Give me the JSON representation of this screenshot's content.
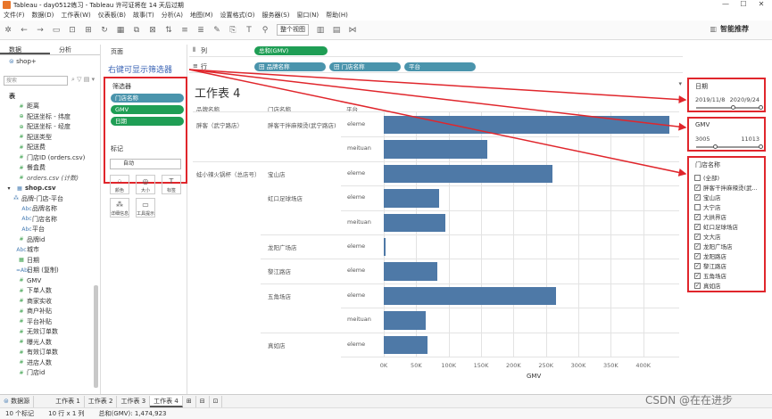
{
  "window": {
    "title": "Tableau - day0512练习 - Tableau 许可证将在 14 天后过期"
  },
  "menu": [
    "文件(F)",
    "数据(D)",
    "工作表(W)",
    "仪表板(B)",
    "故事(T)",
    "分析(A)",
    "地图(M)",
    "设置格式(O)",
    "服务器(S)",
    "窗口(N)",
    "帮助(H)"
  ],
  "toolbar": {
    "view_select": "整个视图",
    "smart_recommend": "智能推荐"
  },
  "data_panel": {
    "tabs": [
      "数据",
      "分析"
    ],
    "source": "shop+",
    "search_placeholder": "搜索",
    "section_table": "表",
    "fields_top": [
      {
        "kind": "msr",
        "label": "距离",
        "icon": "#"
      },
      {
        "kind": "msr",
        "label": "配送坐标 - 纬度",
        "icon": "⊕"
      },
      {
        "kind": "msr",
        "label": "配送坐标 - 经度",
        "icon": "⊕"
      },
      {
        "kind": "msr",
        "label": "配送类型",
        "icon": "#"
      },
      {
        "kind": "msr",
        "label": "配送费",
        "icon": "#"
      },
      {
        "kind": "msr",
        "label": "门店ID (orders.csv)",
        "icon": "#"
      },
      {
        "kind": "msr",
        "label": "餐盒费",
        "icon": "#"
      },
      {
        "kind": "italic",
        "label": "orders.csv (计数)",
        "icon": "#"
      }
    ],
    "shop_table": "shop.csv",
    "hierarchy": "品牌-门店-平台",
    "hierarchy_items": [
      "品牌名称",
      "门店名称",
      "平台"
    ],
    "fields_bottom": [
      {
        "kind": "msr",
        "label": "品牌id",
        "icon": "#"
      },
      {
        "kind": "dim",
        "label": "城市",
        "icon": "Abc"
      },
      {
        "kind": "msr",
        "label": "日期",
        "icon": "▦"
      },
      {
        "kind": "dim",
        "label": "日期 (复制)",
        "icon": "=Abc"
      },
      {
        "kind": "msr",
        "label": "GMV",
        "icon": "#"
      },
      {
        "kind": "msr",
        "label": "下单人数",
        "icon": "#"
      },
      {
        "kind": "msr",
        "label": "商家实收",
        "icon": "#"
      },
      {
        "kind": "msr",
        "label": "商户补贴",
        "icon": "#"
      },
      {
        "kind": "msr",
        "label": "平台补贴",
        "icon": "#"
      },
      {
        "kind": "msr",
        "label": "无效订单数",
        "icon": "#"
      },
      {
        "kind": "msr",
        "label": "曝光人数",
        "icon": "#"
      },
      {
        "kind": "msr",
        "label": "有效订单数",
        "icon": "#"
      },
      {
        "kind": "msr",
        "label": "进店人数",
        "icon": "#"
      },
      {
        "kind": "msr",
        "label": "门店id",
        "icon": "#"
      }
    ]
  },
  "cards": {
    "pages": "页面",
    "filters": "筛选器",
    "annotation": "右键可显示筛选器",
    "filter_pills": [
      "门店名称",
      "GMV",
      "日期"
    ],
    "marks": "标记",
    "marks_type": "自动",
    "mark_buttons": [
      "颜色",
      "大小",
      "标签",
      "详细信息",
      "工具提示"
    ]
  },
  "shelves": {
    "columns_label": "列",
    "columns_pill": "总和(GMV)",
    "rows_label": "行",
    "rows_pills": [
      "田 品牌名称",
      "田 门店名称",
      "平台"
    ]
  },
  "view": {
    "title": "工作表 4",
    "col_headers": [
      "品牌名称",
      "门店名称",
      "平台"
    ],
    "brands": [
      {
        "name": "胖客（武宁路店）",
        "row": 0
      },
      {
        "name": "蛙小辣火锅杯（总店号）",
        "row": 2
      }
    ],
    "stores": [
      {
        "name": "胖客干拌麻辣烫(武宁路店)",
        "row": 0
      },
      {
        "name": "宝山店",
        "row": 2
      },
      {
        "name": "虹口足球场店",
        "row": 3
      },
      {
        "name": "龙阳广场店",
        "row": 5
      },
      {
        "name": "黎江路店",
        "row": 6
      },
      {
        "name": "五角场店",
        "row": 7
      },
      {
        "name": "真如店",
        "row": 9
      }
    ],
    "platforms": [
      "eleme",
      "meituan",
      "eleme",
      "eleme",
      "meituan",
      "eleme",
      "eleme",
      "eleme",
      "meituan",
      "eleme"
    ]
  },
  "chart_data": {
    "type": "bar",
    "orientation": "horizontal",
    "categories": [
      "胖客干拌麻辣烫(武宁路店) eleme",
      "胖客干拌麻辣烫(武宁路店) meituan",
      "宝山店 eleme",
      "虹口足球场店 eleme",
      "虹口足球场店 meituan",
      "龙阳广场店 eleme",
      "黎江路店 eleme",
      "五角场店 eleme",
      "五角场店 meituan",
      "真如店 eleme"
    ],
    "values": [
      441000,
      160000,
      260000,
      85000,
      95000,
      3000,
      83000,
      265000,
      65000,
      67000
    ],
    "xlabel": "GMV",
    "xlim": [
      0,
      450000
    ],
    "x_ticks": [
      "0K",
      "50K",
      "100K",
      "150K",
      "200K",
      "250K",
      "300K",
      "350K",
      "400K"
    ],
    "color": "#4e79a7"
  },
  "right_filters": {
    "date": {
      "title": "日期",
      "start": "2019/11/8",
      "end": "2020/9/24"
    },
    "gmv": {
      "title": "GMV",
      "min": "3005",
      "max": "11013"
    },
    "stores": {
      "title": "门店名称",
      "items": [
        {
          "label": "(全部)",
          "checked": false
        },
        {
          "label": "胖客干拌麻辣烫(武...",
          "checked": true
        },
        {
          "label": "宝山店",
          "checked": true
        },
        {
          "label": "大宁店",
          "checked": false
        },
        {
          "label": "大拱界店",
          "checked": true
        },
        {
          "label": "虹口足球场店",
          "checked": true
        },
        {
          "label": "文大店",
          "checked": true
        },
        {
          "label": "龙阳广场店",
          "checked": true
        },
        {
          "label": "龙阳路店",
          "checked": true
        },
        {
          "label": "黎江路店",
          "checked": true
        },
        {
          "label": "五角场店",
          "checked": true
        },
        {
          "label": "真如店",
          "checked": true
        }
      ]
    }
  },
  "sheet_tabs": [
    "数据源",
    "工作表 1",
    "工作表 2",
    "工作表 3",
    "工作表 4"
  ],
  "status": {
    "marks": "10 个标记",
    "rows_cols": "10 行 x 1 列",
    "sum": "总和(GMV): 1,474,923"
  },
  "watermark": "CSDN @在在进步"
}
